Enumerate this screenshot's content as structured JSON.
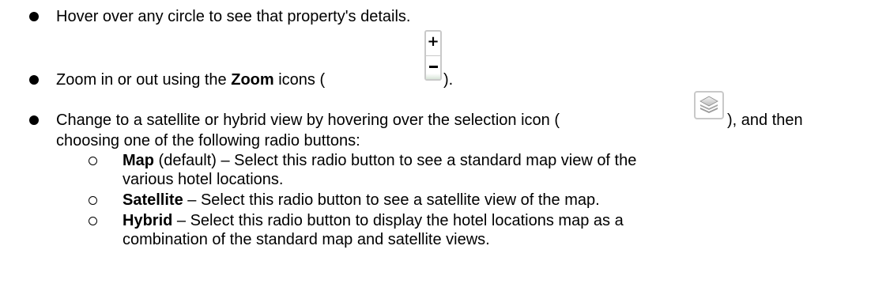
{
  "instructions": {
    "hover": {
      "text": "Hover over any circle to see that property's details."
    },
    "zoom": {
      "before": "Zoom in or out using the ",
      "bold": "Zoom",
      "middle": " icons (",
      "after": ").",
      "icon_plus": "+",
      "icon_name": "zoom-control-icon"
    },
    "layers": {
      "line1_before": "Change to a satellite or hybrid view by hovering over the selection icon (",
      "line1_after": "), and then",
      "line2": "choosing one of the following radio buttons:",
      "icon_name": "layers-icon"
    },
    "options": [
      {
        "name": "Map",
        "line1": " (default) – Select this radio button to see a standard map view of the",
        "line2": "various hotel locations."
      },
      {
        "name": "Satellite",
        "line1": " – Select this radio button to see a satellite view of the map.",
        "line2": ""
      },
      {
        "name": "Hybrid",
        "line1": " – Select this radio button to display the hotel locations map as a",
        "line2": "combination of the standard map and satellite views."
      }
    ]
  }
}
